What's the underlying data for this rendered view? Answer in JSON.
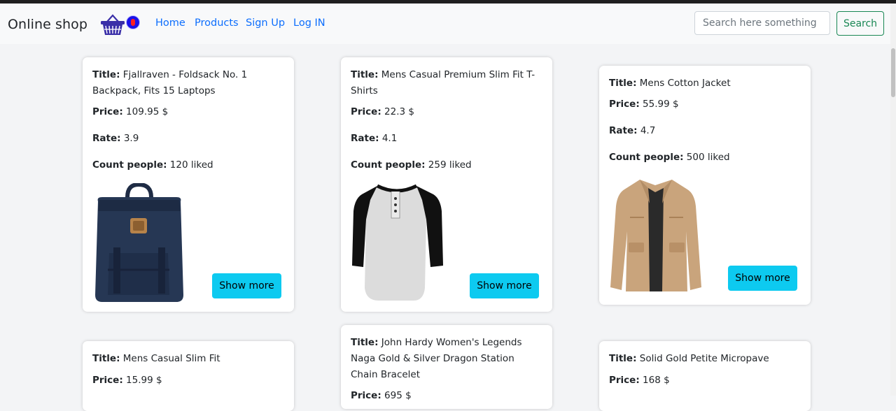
{
  "navbar": {
    "brand": "Online shop",
    "cart_count": "0",
    "links": [
      "Home",
      "Products",
      "Sign Up",
      "Log IN"
    ],
    "search_placeholder": "Search here something",
    "search_button": "Search"
  },
  "labels": {
    "title": "Title:",
    "price": "Price:",
    "rate": "Rate:",
    "count": "Count people:",
    "show_more": "Show more"
  },
  "products": [
    {
      "title": "Fjallraven - Foldsack No. 1 Backpack, Fits 15 Laptops",
      "price": "109.95 $",
      "rate": "3.9",
      "count": "120 liked",
      "image": "backpack"
    },
    {
      "title": "Mens Casual Premium Slim Fit T-Shirts",
      "price": "22.3 $",
      "rate": "4.1",
      "count": "259 liked",
      "image": "tshirt"
    },
    {
      "title": "Mens Cotton Jacket",
      "price": "55.99 $",
      "rate": "4.7",
      "count": "500 liked",
      "image": "jacket"
    },
    {
      "title": "Mens Casual Slim Fit",
      "price": "15.99 $"
    },
    {
      "title": "John Hardy Women's Legends Naga Gold & Silver Dragon Station Chain Bracelet",
      "price": "695 $"
    },
    {
      "title": "Solid Gold Petite Micropave",
      "price": "168 $"
    }
  ],
  "colors": {
    "link": "#0d6efd",
    "search_button": "#198754",
    "show_more_button": "#0dcaf0",
    "cart_badge": "#1b12e8"
  }
}
